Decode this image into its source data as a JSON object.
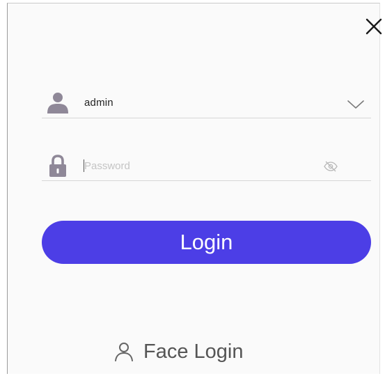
{
  "dialog": {
    "username": {
      "value": "admin",
      "icon": "user-icon",
      "dropdown_icon": "chevron-down-icon"
    },
    "password": {
      "placeholder": "Password",
      "value": "",
      "icon": "lock-icon",
      "toggle_icon": "eye-slash-icon"
    },
    "login_button_label": "Login",
    "face_login": {
      "label": "Face Login",
      "icon": "person-outline-icon"
    },
    "close_icon": "close-icon",
    "colors": {
      "accent": "#4c3ee6",
      "icon_gray": "#8f8898",
      "text": "#222222",
      "placeholder": "#c4c4c4"
    }
  }
}
